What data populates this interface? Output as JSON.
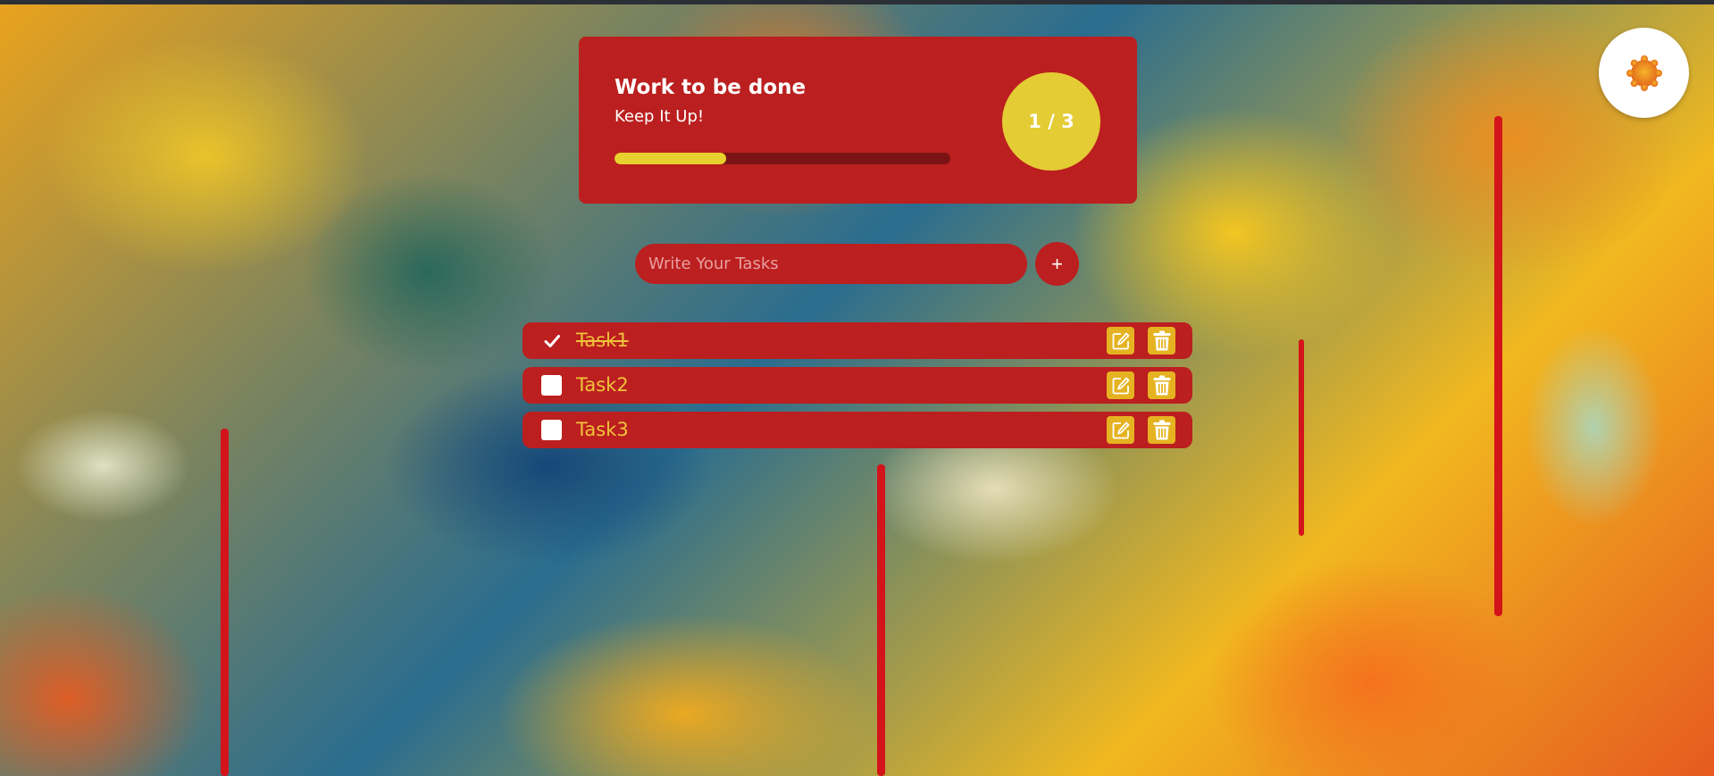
{
  "summary": {
    "title": "Work to be done",
    "subtitle": "Keep It Up!",
    "progress": {
      "completed": 1,
      "total": 3,
      "fraction": 0.333
    },
    "count_label": "1 / 3"
  },
  "input": {
    "placeholder": "Write Your Tasks",
    "value": ""
  },
  "add_button": {
    "label": "+"
  },
  "tasks": [
    {
      "label": "Task1",
      "done": true
    },
    {
      "label": "Task2",
      "done": false
    },
    {
      "label": "Task3",
      "done": false
    }
  ],
  "theme_toggle": {
    "icon": "sun-icon"
  },
  "colors": {
    "panel": "#bc1f1f",
    "accent": "#e4cc35",
    "task_text": "#f0c23a",
    "icon_button": "#e5b321",
    "progress_track": "#7a1414"
  }
}
